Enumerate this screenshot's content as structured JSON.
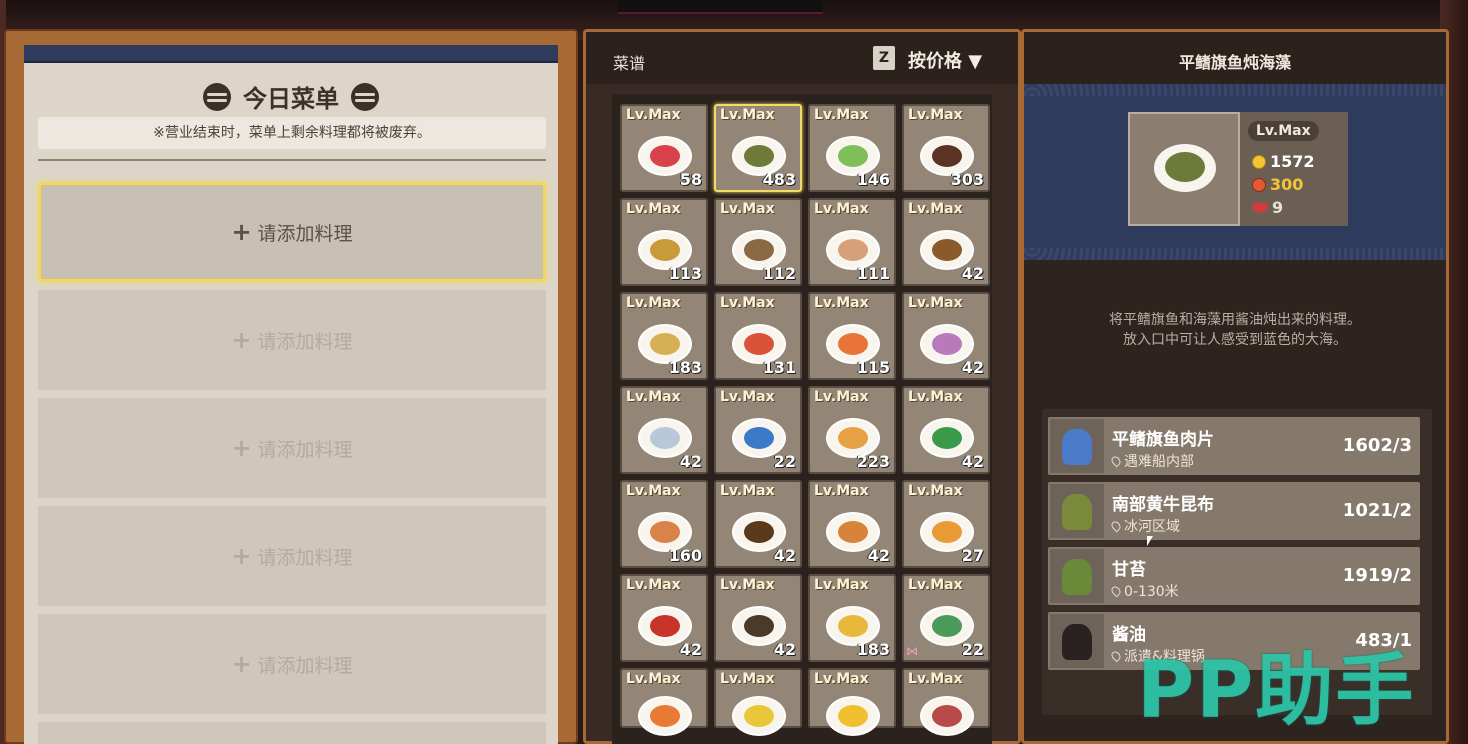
{
  "left": {
    "title": "今日菜单",
    "notice": "※营业结束时，菜单上剩余料理都将被废弃。",
    "slot_label": "请添加料理",
    "slot_plus": "+"
  },
  "recipes": {
    "title": "菜谱",
    "sort_key": "Z",
    "sort_label": "按价格 ▼",
    "level_label": "Lv.Max",
    "counts": [
      "58",
      "483",
      "146",
      "303",
      "113",
      "112",
      "111",
      "42",
      "183",
      "131",
      "115",
      "42",
      "42",
      "22",
      "223",
      "42",
      "160",
      "42",
      "42",
      "27",
      "42",
      "42",
      "183",
      "22",
      "",
      "",
      "",
      ""
    ],
    "food_colors": [
      "#d9424b",
      "#6e7a3a",
      "#7fbf5a",
      "#5a3322",
      "#c89a3a",
      "#8a6a44",
      "#d8a07a",
      "#8a5a2a",
      "#d8b054",
      "#d9523a",
      "#e8743a",
      "#b87ab8",
      "#b8c8d8",
      "#3a7ac8",
      "#e8a044",
      "#3a9a4a",
      "#d8834a",
      "#5a3a1a",
      "#d8833a",
      "#e89a34",
      "#c8342a",
      "#4a3a2a",
      "#e8b83a",
      "#4a9a5a",
      "#e87a34",
      "#e8c83a",
      "#f0c030",
      "#b84a4a"
    ],
    "selected_index": 1,
    "bow_index": 23
  },
  "detail": {
    "title": "平鳍旗鱼炖海藻",
    "level": "Lv.Max",
    "price": "1572",
    "taste": "300",
    "servings": "9",
    "description_line1": "将平鳍旗鱼和海藻用酱油炖出来的料理。",
    "description_line2": "放入口中可让人感受到蓝色的大海。",
    "ingredients": [
      {
        "name": "平鳍旗鱼肉片",
        "location": "遇难船内部",
        "count": "1602/3",
        "color": "#4a7ac8"
      },
      {
        "name": "南部黄牛昆布",
        "location": "冰河区域",
        "count": "1021/2",
        "color": "#7a8a3a"
      },
      {
        "name": "甘苔",
        "location": "0-130米",
        "count": "1919/2",
        "color": "#6a8a3a"
      },
      {
        "name": "酱油",
        "location": "派遣&料理锅",
        "count": "483/1",
        "color": "#2a2220"
      }
    ]
  },
  "watermark": "PP助手",
  "colors": {
    "accent_gold": "#f3db65",
    "panel_orange": "#a86a34",
    "navy": "#2e3b5c",
    "watermark": "#2ec4a8"
  }
}
